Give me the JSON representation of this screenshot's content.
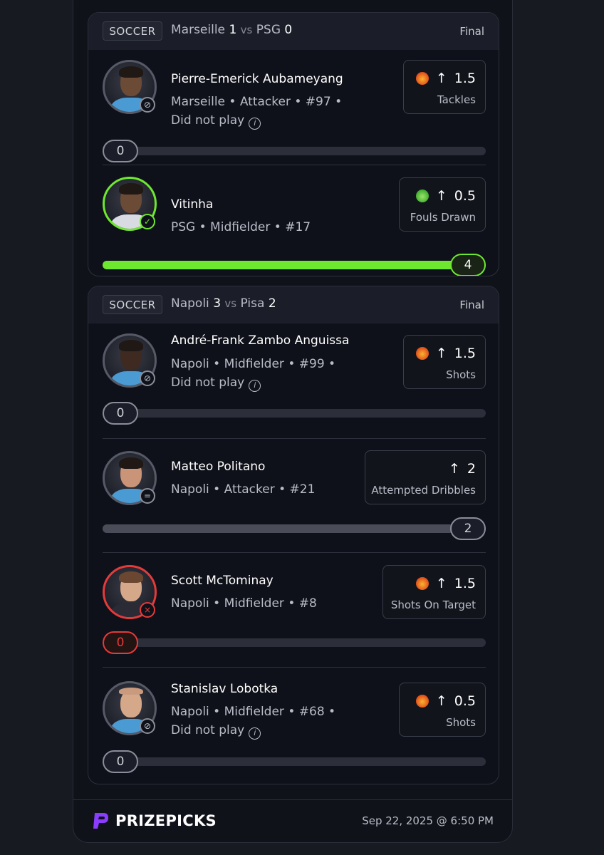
{
  "cards": [
    {
      "sport": "SOCCER",
      "home": "Marseille",
      "home_score": "1",
      "vs": "vs",
      "away": "PSG",
      "away_score": "0",
      "status": "Final",
      "players": [
        {
          "name": "Pierre-Emerick Aubameyang",
          "info": "Marseille • Attacker • #97 •",
          "note": "Did not play",
          "line": "1.5",
          "stat": "Tackles",
          "result": "0",
          "progress": 0,
          "state": "dnp",
          "icon": "demon-icon"
        },
        {
          "name": "Vitinha",
          "info": "PSG • Midfielder • #17",
          "note": "",
          "line": "0.5",
          "stat": "Fouls Drawn",
          "result": "4",
          "progress": 1.0,
          "state": "win",
          "icon": "goblin-icon"
        }
      ]
    },
    {
      "sport": "SOCCER",
      "home": "Napoli",
      "home_score": "3",
      "vs": "vs",
      "away": "Pisa",
      "away_score": "2",
      "status": "Final",
      "players": [
        {
          "name": "André-Frank Zambo Anguissa",
          "info": "Napoli • Midfielder • #99 •",
          "note": "Did not play",
          "line": "1.5",
          "stat": "Shots",
          "result": "0",
          "progress": 0,
          "state": "dnp",
          "icon": "demon-icon"
        },
        {
          "name": "Matteo Politano",
          "info": "Napoli • Attacker • #21",
          "note": "",
          "line": "2",
          "stat": "Attempted Dribbles",
          "result": "2",
          "progress": 1.0,
          "state": "push",
          "icon": ""
        },
        {
          "name": "Scott McTominay",
          "info": "Napoli • Midfielder • #8",
          "note": "",
          "line": "1.5",
          "stat": "Shots On Target",
          "result": "0",
          "progress": 0,
          "state": "loss",
          "icon": "demon-icon"
        },
        {
          "name": "Stanislav Lobotka",
          "info": "Napoli • Midfielder • #68 •",
          "note": "Did not play",
          "line": "0.5",
          "stat": "Shots",
          "result": "0",
          "progress": 0,
          "state": "dnp",
          "icon": "demon-icon"
        }
      ]
    }
  ],
  "footer": {
    "brand": "PRIZEPICKS",
    "timestamp": "Sep 22, 2025 @ 6:50 PM"
  },
  "colors": {
    "win": "#6ee82f",
    "loss": "#e53a3a",
    "neutral": "#8a8e99",
    "brand": "#8b3dff"
  }
}
